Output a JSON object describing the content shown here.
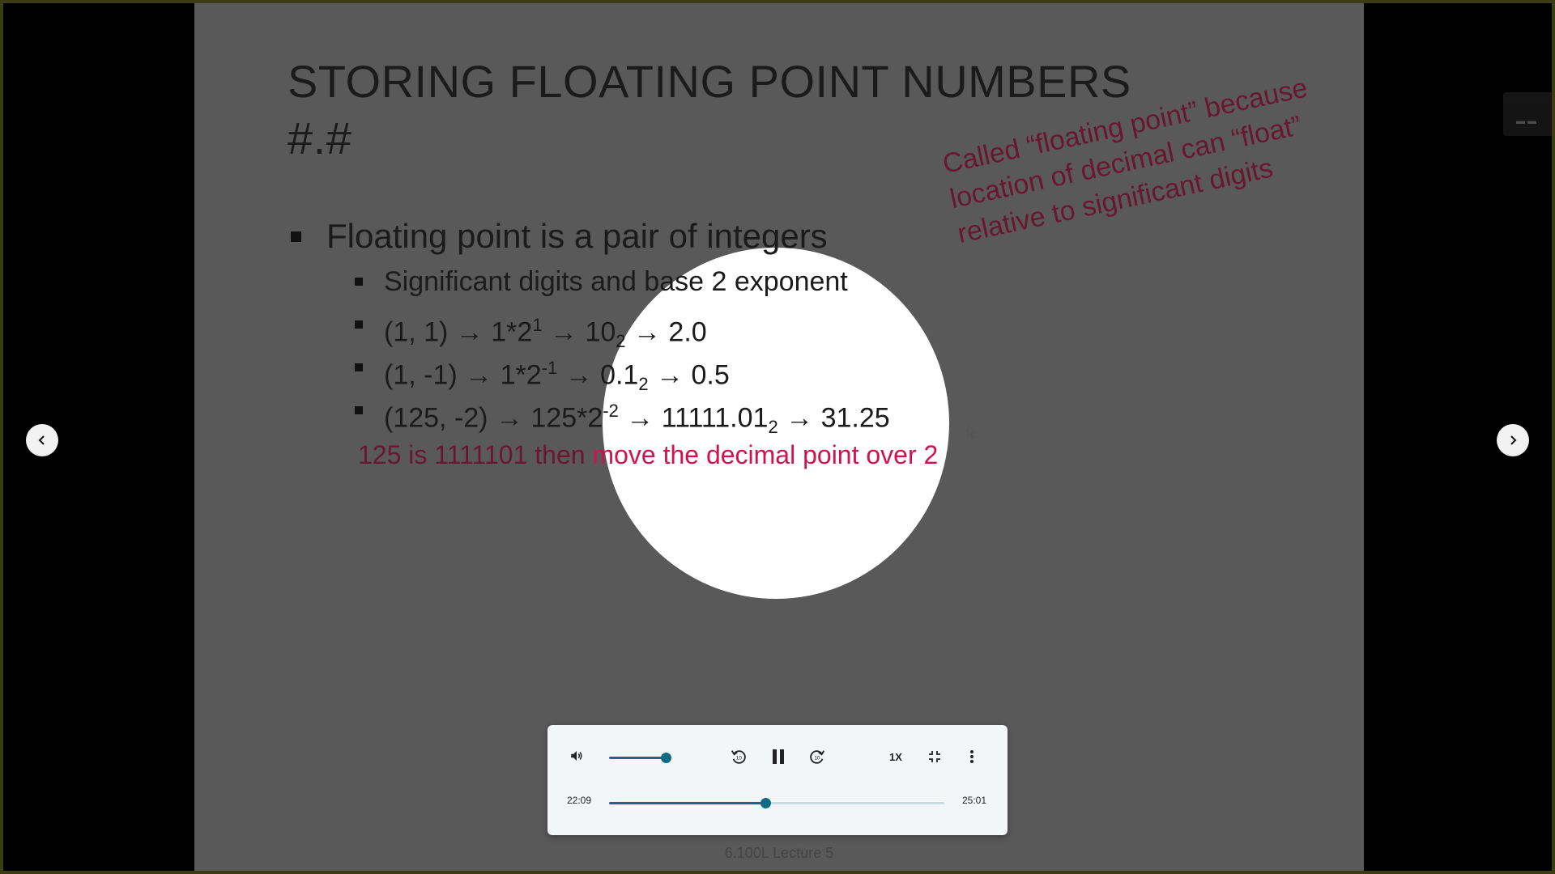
{
  "slide": {
    "title_line1": "STORING FLOATING POINT NUMBERS",
    "title_line2": "#.#",
    "bullet_main": "Floating point is a pair of integers",
    "sub1": "Significant digits and base 2 exponent",
    "sub2": {
      "a": "(1, 1) → 1*2",
      "exp": "1",
      "b": " → 10",
      "base": "2",
      "c": " → 2.0"
    },
    "sub3": {
      "a": "(1, -1) → 1*2",
      "exp": "-1",
      "b": " → 0.1",
      "base": "2",
      "c": " → 0.5"
    },
    "sub4": {
      "a": "(125, -2) → 125*2",
      "exp": "-2",
      "b": " →  11111.01",
      "base": "2",
      "c": " → 31.25"
    },
    "red_note_part1": "125 is 1111101 then ",
    "red_note_part2": "move the decimal point over 2",
    "annotation_line1": "Called “floating point” because",
    "annotation_line2": "location of decimal can “float”",
    "annotation_line3": "relative to significant digits",
    "footer": "6.100L Lecture 5"
  },
  "player": {
    "current_time": "22:09",
    "duration": "25:01",
    "speed_label": "1X",
    "progress_fraction": 0.4654,
    "volume_fraction": 0.82
  },
  "icons": {
    "volume": "volume-icon",
    "rewind": "rewind-10-icon",
    "pause": "pause-icon",
    "forward": "forward-10-icon",
    "exit_fullscreen": "exit-fullscreen-icon",
    "more": "more-vertical-icon",
    "prev": "chevron-left-icon",
    "next": "chevron-right-icon"
  },
  "colors": {
    "accent": "#0f6b85",
    "highlight_text": "#d0124e",
    "annotation_text": "#6a1630"
  }
}
